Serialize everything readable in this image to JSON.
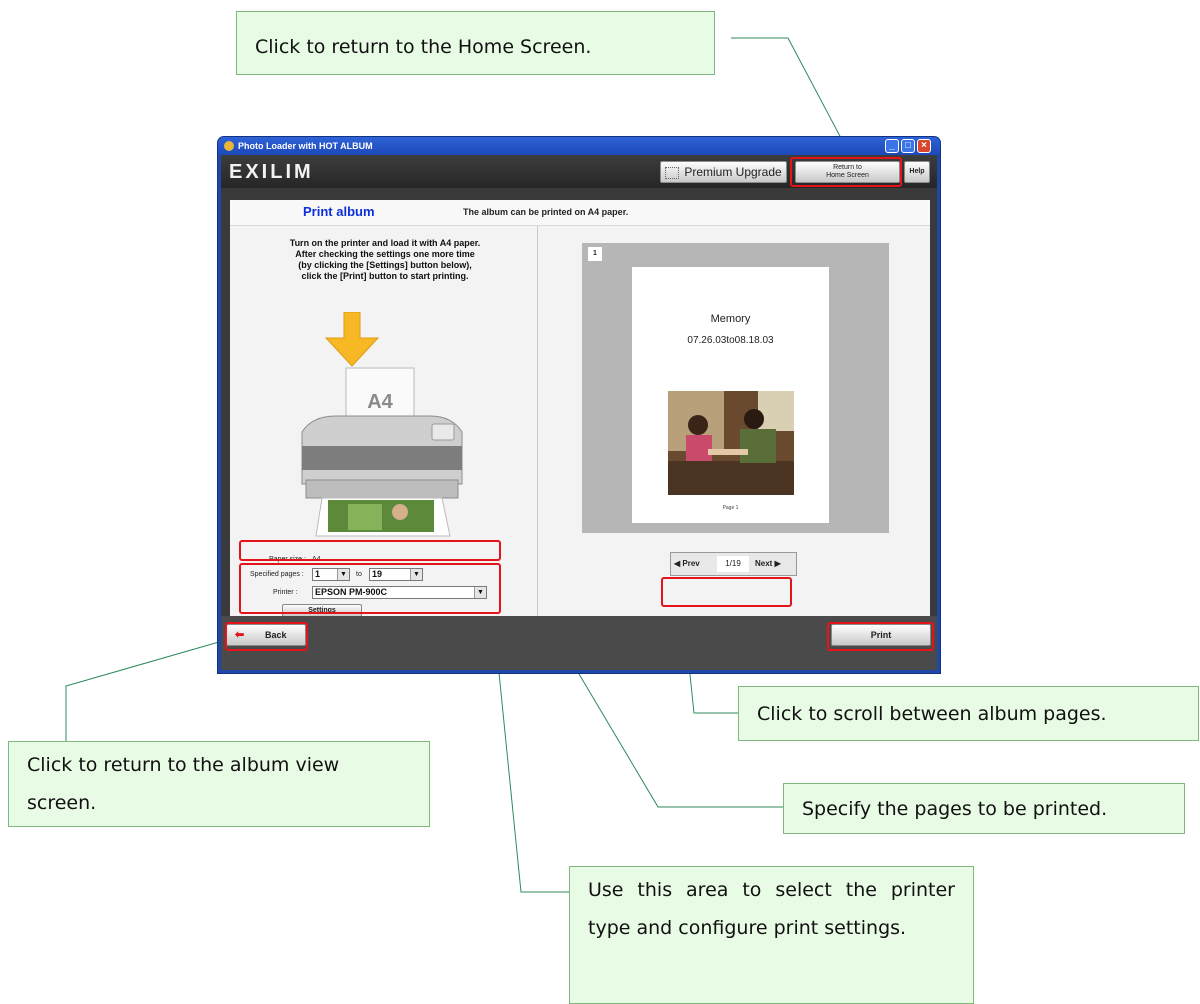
{
  "callouts": {
    "home": "Click to return to the Home Screen.",
    "scroll": "Click to scroll between album pages.",
    "back": "Click to return to the album view screen.",
    "pages": "Specify the pages to be printed.",
    "printer": "Use this area to select the printer type and configure print settings."
  },
  "window": {
    "title": "Photo Loader with HOT ALBUM",
    "controls": [
      "_",
      "□",
      "×"
    ]
  },
  "header": {
    "logo": "EXILIM",
    "premium_upgrade": "Premium Upgrade",
    "return_home_line1": "Return to",
    "return_home_line2": "Home Screen",
    "help": "Help"
  },
  "page": {
    "title": "Print album",
    "description": "The album can be printed on A4 paper."
  },
  "instructions": [
    "Turn on the printer and load it with A4 paper.",
    "After checking the settings one more time",
    "(by clicking the [Settings] button below),",
    "click the [Print] button to start printing."
  ],
  "illustration": {
    "paper_label": "A4"
  },
  "settings": {
    "paper_size_label": "Paper size :",
    "paper_size_value": "A4",
    "specified_pages_label": "Specified pages :",
    "from_page": "1",
    "to_label": "to",
    "to_page": "19",
    "printer_label": "Printer :",
    "printer_value": "EPSON PM-900C",
    "settings_button": "Settings"
  },
  "preview": {
    "page_number": "1",
    "album_title": "Memory",
    "date_range": "07.26.03to08.18.03",
    "footer": "Page 1"
  },
  "navigation": {
    "prev": "Prev",
    "counter": "1/19",
    "next": "Next"
  },
  "footer": {
    "back": "Back",
    "print": "Print"
  },
  "colors": {
    "callout_bg": "#e8fbe4",
    "highlight": "#e5131a",
    "title_blue": "#0a2fdb"
  }
}
